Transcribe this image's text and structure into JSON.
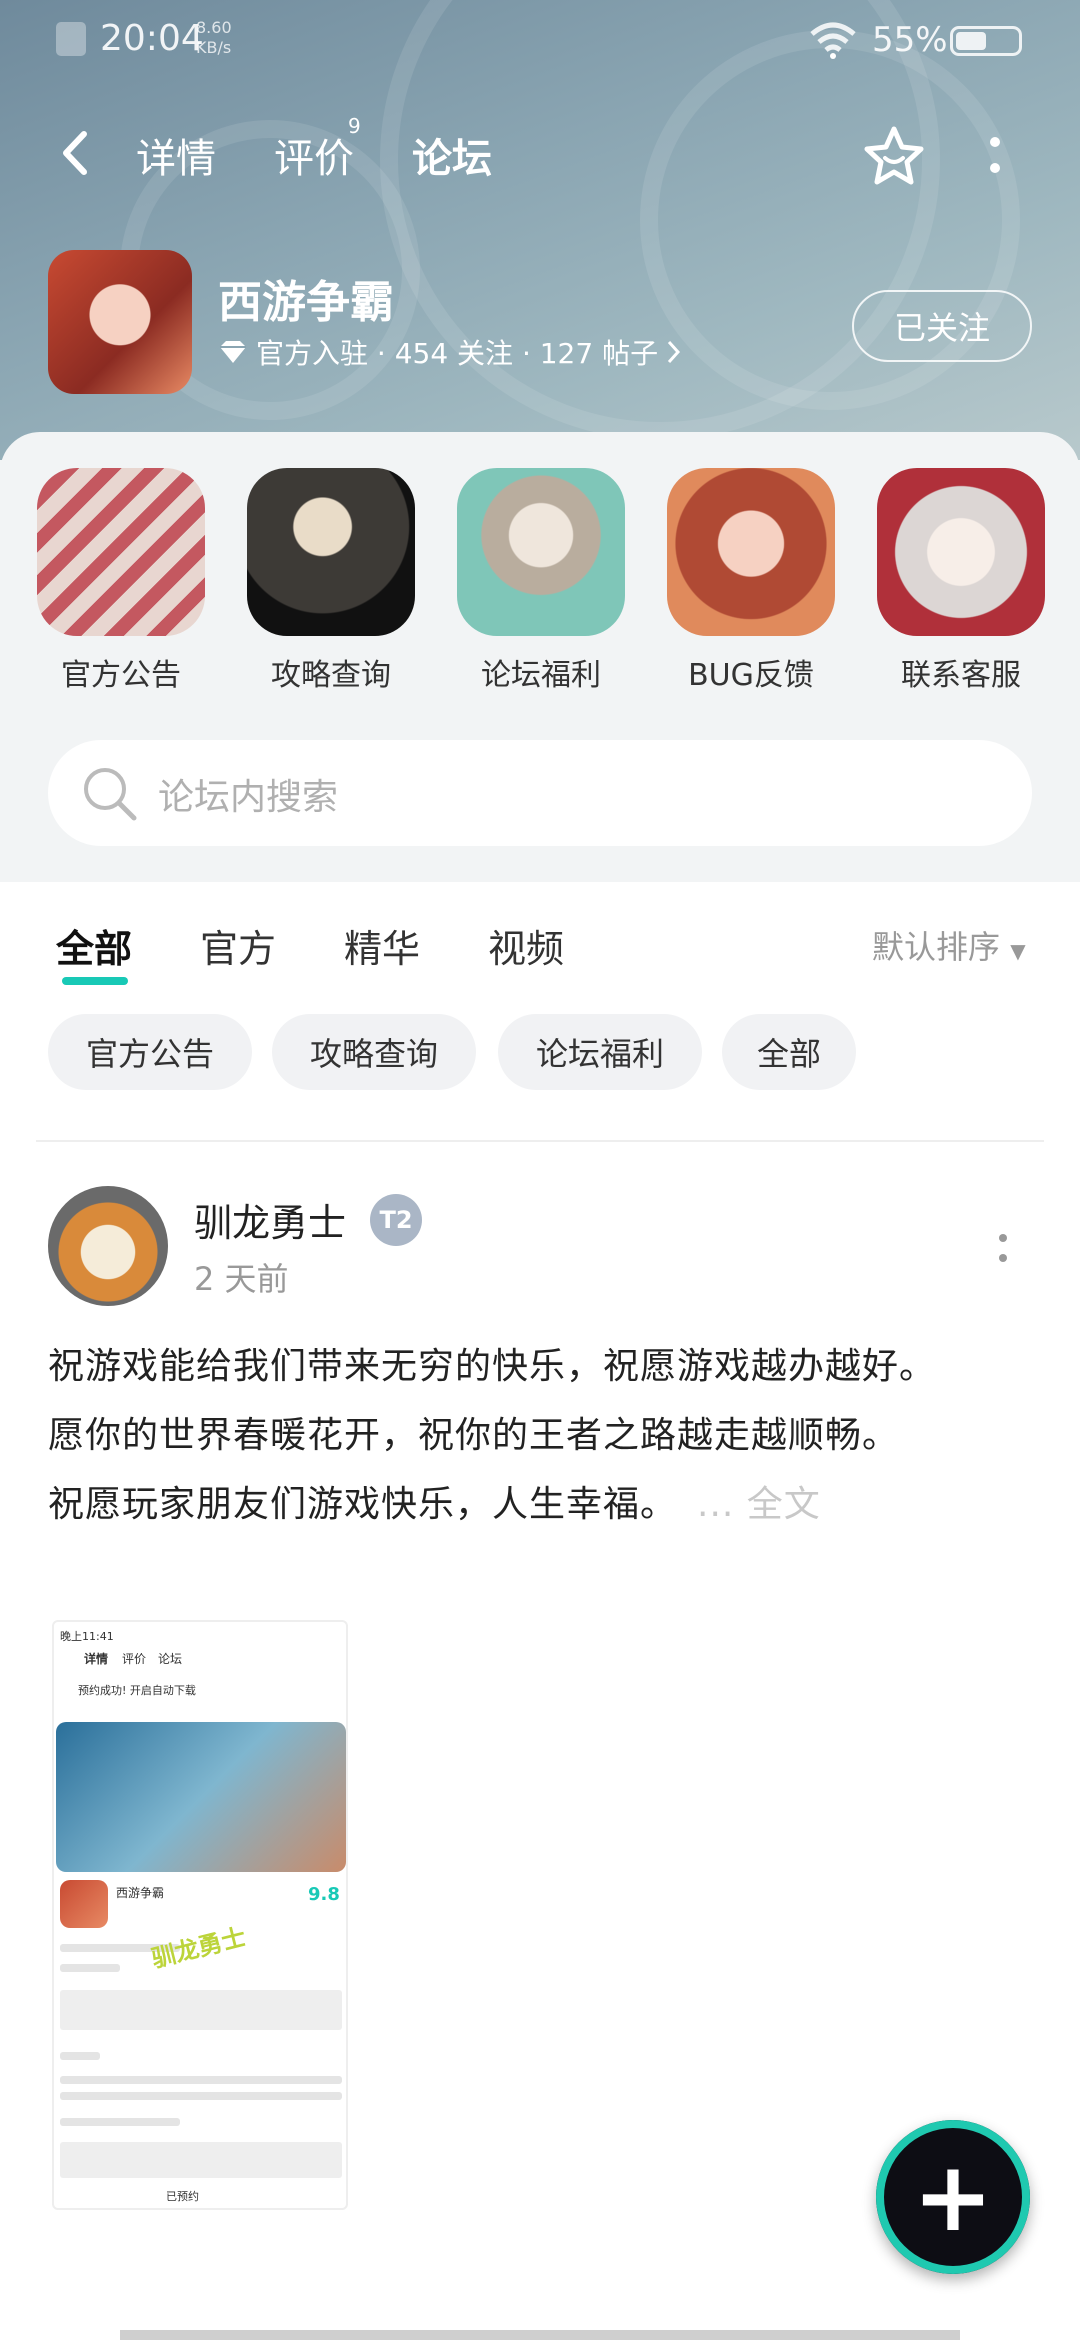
{
  "status_bar": {
    "time": "20:04",
    "speed_value": "8.60",
    "speed_unit": "KB/s",
    "battery": "55%"
  },
  "top_nav": {
    "tabs": [
      {
        "label": "详情"
      },
      {
        "label": "评价",
        "badge": "9"
      },
      {
        "label": "论坛"
      }
    ],
    "active_tab": "论坛"
  },
  "game": {
    "name": "西游争霸",
    "meta": "官方入驻 · 454 关注 · 127 帖子",
    "follow_label": "已关注"
  },
  "shortcuts": [
    {
      "label": "官方公告"
    },
    {
      "label": "攻略查询"
    },
    {
      "label": "论坛福利"
    },
    {
      "label": "BUG反馈"
    },
    {
      "label": "联系客服"
    }
  ],
  "search": {
    "placeholder": "论坛内搜索"
  },
  "feed_tabs": [
    {
      "label": "全部"
    },
    {
      "label": "官方"
    },
    {
      "label": "精华"
    },
    {
      "label": "视频"
    }
  ],
  "sort_label": "默认排序",
  "chips": [
    {
      "label": "官方公告"
    },
    {
      "label": "攻略查询"
    },
    {
      "label": "论坛福利"
    },
    {
      "label": "全部"
    }
  ],
  "post": {
    "author": "驯龙勇士",
    "badge": "T2",
    "time": "2 天前",
    "line1": "祝游戏能给我们带来无穷的快乐，祝愿游戏越办越好。",
    "line2": "愿你的世界春暖花开，祝你的王者之路越走越顺畅。",
    "line3": "祝愿玩家朋友们游戏快乐，人生幸福。",
    "full_label": "... 全文",
    "screenshot": {
      "time": "晚上11:41",
      "tabs": [
        "详情",
        "评价",
        "论坛"
      ],
      "notice": "预约成功! 开启自动下载",
      "game_name": "西游争霸",
      "score": "9.8",
      "watermark": "驯龙勇士",
      "button": "已预约"
    }
  },
  "colors": {
    "accent": "#18c9b6",
    "hero_bg": "#8aa5b2"
  }
}
